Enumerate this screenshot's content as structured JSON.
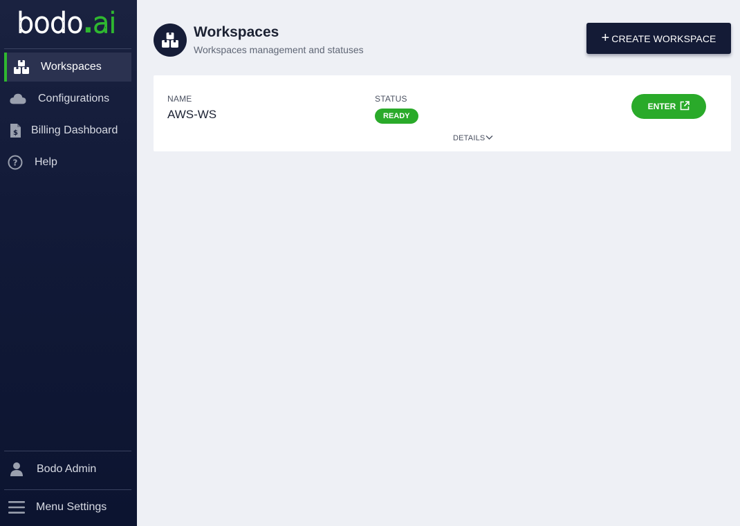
{
  "app": {
    "logo_main": "bodo",
    "logo_dot": ".",
    "logo_ai": "ai"
  },
  "sidebar": {
    "items": [
      {
        "label": "Workspaces",
        "icon": "workspaces-icon",
        "active": true
      },
      {
        "label": "Configurations",
        "icon": "cloud-icon",
        "active": false
      },
      {
        "label": "Billing Dashboard",
        "icon": "billing-icon",
        "active": false
      },
      {
        "label": "Help",
        "icon": "help-icon",
        "active": false
      }
    ],
    "user_label": "Bodo Admin",
    "menu_settings_label": "Menu Settings"
  },
  "header": {
    "title": "Workspaces",
    "subtitle": "Workspaces management and statuses",
    "create_button_label": "CREATE WORKSPACE"
  },
  "workspace": {
    "name_header": "NAME",
    "status_header": "STATUS",
    "name": "AWS-WS",
    "status": "READY",
    "enter_label": "ENTER",
    "details_label": "DETAILS"
  },
  "colors": {
    "accent_green": "#2aaa2a",
    "sidebar_bg": "#121a38",
    "primary_dark": "#141b36"
  }
}
